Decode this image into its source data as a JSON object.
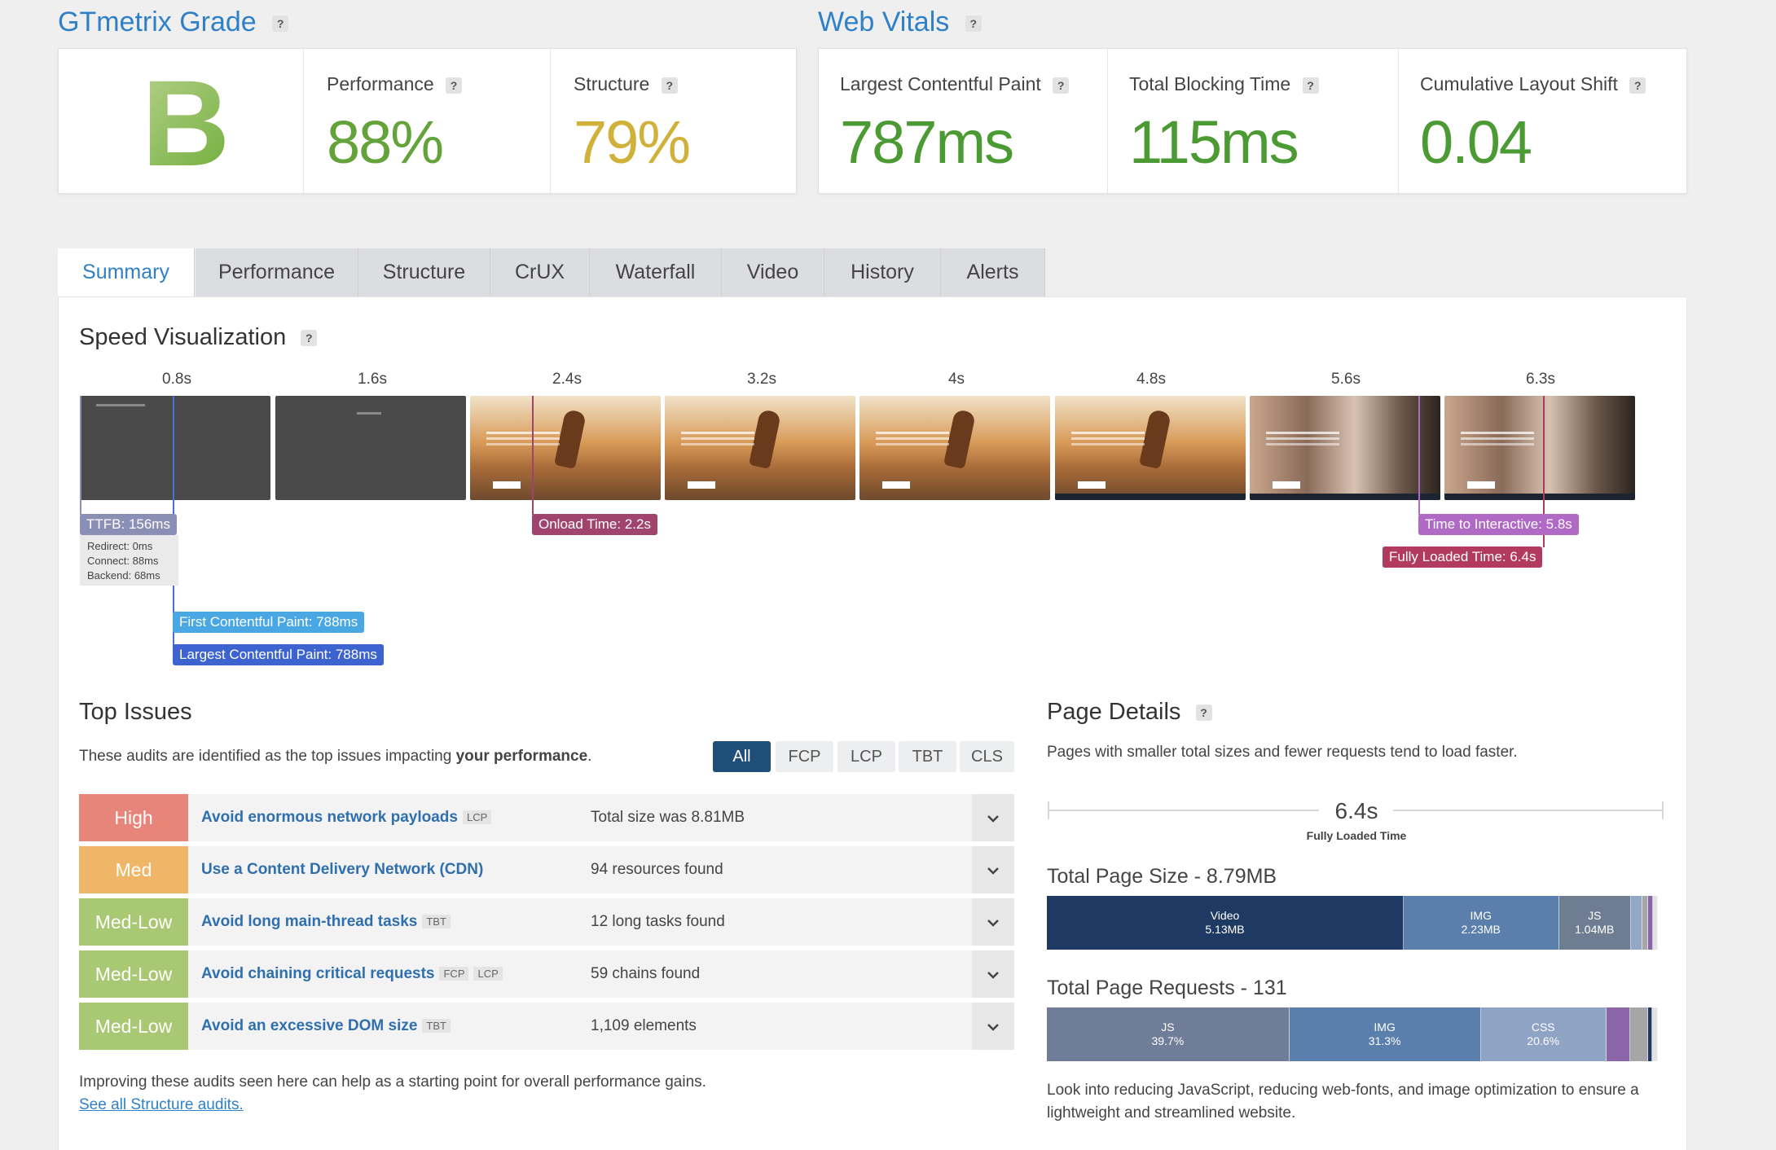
{
  "grade": {
    "title": "GTmetrix Grade",
    "letter": "B",
    "performance": {
      "label": "Performance",
      "value": "88%"
    },
    "structure": {
      "label": "Structure",
      "value": "79%"
    }
  },
  "web_vitals": {
    "title": "Web Vitals",
    "lcp": {
      "label": "Largest Contentful Paint",
      "value": "787ms"
    },
    "tbt": {
      "label": "Total Blocking Time",
      "value": "115ms"
    },
    "cls": {
      "label": "Cumulative Layout Shift",
      "value": "0.04"
    }
  },
  "help_glyph": "?",
  "tabs": [
    "Summary",
    "Performance",
    "Structure",
    "CrUX",
    "Waterfall",
    "Video",
    "History",
    "Alerts"
  ],
  "speed": {
    "title": "Speed Visualization",
    "frame_times": [
      "0.8s",
      "1.6s",
      "2.4s",
      "3.2s",
      "4s",
      "4.8s",
      "5.6s",
      "6.3s"
    ],
    "ttfb": "TTFB: 156ms",
    "ttfb_details": [
      "Redirect: 0ms",
      "Connect: 88ms",
      "Backend: 68ms"
    ],
    "onload": "Onload Time: 2.2s",
    "tti": "Time to Interactive: 5.8s",
    "fully_loaded": "Fully Loaded Time: 6.4s",
    "fcp": "First Contentful Paint: 788ms",
    "lcp": "Largest Contentful Paint: 788ms"
  },
  "top_issues": {
    "title": "Top Issues",
    "intro_prefix": "These audits are identified as the top issues impacting",
    "intro_bold": "your performance",
    "intro_suffix": ".",
    "filters": [
      "All",
      "FCP",
      "LCP",
      "TBT",
      "CLS"
    ],
    "issues": [
      {
        "severity": "High",
        "color": "#e8857a",
        "title": "Avoid enormous network payloads",
        "tags": [
          "LCP"
        ],
        "detail": "Total size was 8.81MB"
      },
      {
        "severity": "Med",
        "color": "#efb667",
        "title": "Use a Content Delivery Network (CDN)",
        "tags": [],
        "detail": "94 resources found"
      },
      {
        "severity": "Med-Low",
        "color": "#a9c873",
        "title": "Avoid long main-thread tasks",
        "tags": [
          "TBT"
        ],
        "detail": "12 long tasks found"
      },
      {
        "severity": "Med-Low",
        "color": "#a9c873",
        "title": "Avoid chaining critical requests",
        "tags": [
          "FCP",
          "LCP"
        ],
        "detail": "59 chains found"
      },
      {
        "severity": "Med-Low",
        "color": "#a9c873",
        "title": "Avoid an excessive DOM size",
        "tags": [
          "TBT"
        ],
        "detail": "1,109 elements"
      }
    ],
    "footer": "Improving these audits seen here can help as a starting point for overall performance gains.",
    "link": "See all Structure audits."
  },
  "page_details": {
    "title": "Page Details",
    "subtitle": "Pages with smaller total sizes and fewer requests tend to load faster.",
    "fully_loaded_value": "6.4s",
    "fully_loaded_label": "Fully Loaded Time",
    "size_title": "Total Page Size - 8.79MB",
    "size_segments": [
      {
        "label": "Video",
        "value": "5.13MB",
        "color": "#1f3a62",
        "fraction": 0.584
      },
      {
        "label": "IMG",
        "value": "2.23MB",
        "color": "#5b7fad",
        "fraction": 0.254
      },
      {
        "label": "JS",
        "value": "1.04MB",
        "color": "#6f7d92",
        "fraction": 0.118
      },
      {
        "label": "",
        "value": "",
        "color": "#93a8c6",
        "fraction": 0.018
      },
      {
        "label": "",
        "value": "",
        "color": "#a6a6a6",
        "fraction": 0.01
      },
      {
        "label": "",
        "value": "",
        "color": "#8a65a8",
        "fraction": 0.008
      },
      {
        "label": "",
        "value": "",
        "color": "#e3e3e3",
        "fraction": 0.008
      }
    ],
    "requests_title": "Total Page Requests - 131",
    "request_segments": [
      {
        "label": "JS",
        "value": "39.7%",
        "color": "#6f7d98",
        "fraction": 0.397
      },
      {
        "label": "IMG",
        "value": "31.3%",
        "color": "#5b7fad",
        "fraction": 0.313
      },
      {
        "label": "CSS",
        "value": "20.6%",
        "color": "#8fa3c4",
        "fraction": 0.206
      },
      {
        "label": "",
        "value": "",
        "color": "#8a65a8",
        "fraction": 0.038
      },
      {
        "label": "",
        "value": "",
        "color": "#a6a6a6",
        "fraction": 0.03
      },
      {
        "label": "",
        "value": "",
        "color": "#1f3a62",
        "fraction": 0.006
      },
      {
        "label": "",
        "value": "",
        "color": "#e3e3e3",
        "fraction": 0.01
      }
    ],
    "note": "Look into reducing JavaScript, reducing web-fonts, and image optimization to ensure a lightweight and streamlined website."
  }
}
